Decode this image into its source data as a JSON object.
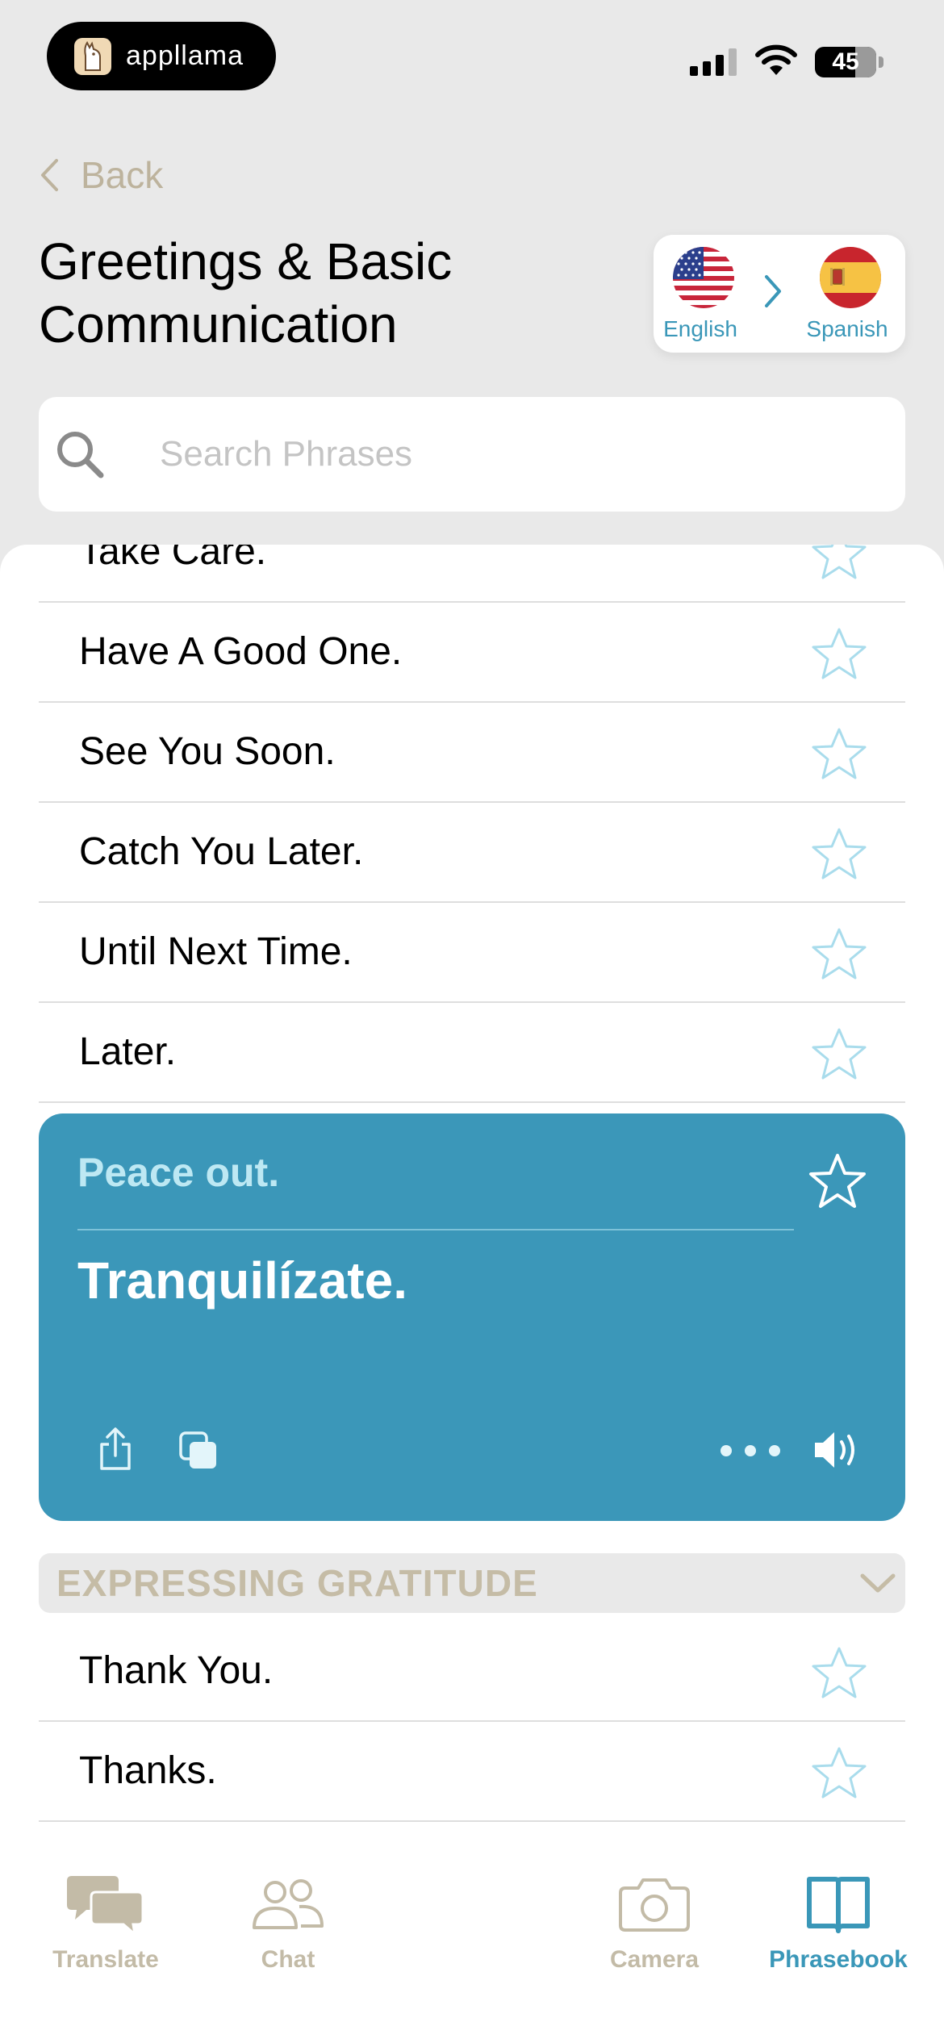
{
  "status_bar": {
    "app_name": "appllama",
    "battery": "45"
  },
  "header": {
    "back_label": "Back",
    "title": "Greetings & Basic Communication",
    "source_language": "English",
    "target_language": "Spanish"
  },
  "search": {
    "placeholder": "Search Phrases"
  },
  "phrases": {
    "partial_top": "Take Care.",
    "items": [
      "Have A Good One.",
      "See You Soon.",
      "Catch You Later.",
      "Until Next Time.",
      "Later."
    ]
  },
  "translation_card": {
    "source": "Peace out.",
    "target": "Tranquilízate.",
    "color": "#3b97b9"
  },
  "section": {
    "title": "EXPRESSING GRATITUDE",
    "items": [
      "Thank You.",
      "Thanks."
    ]
  },
  "tabs": {
    "translate": "Translate",
    "chat": "Chat",
    "camera": "Camera",
    "phrasebook": "Phrasebook",
    "active": "phrasebook"
  },
  "colors": {
    "accent": "#3a97b8",
    "muted": "#bdb39d",
    "star_outline": "#a9dcec"
  }
}
